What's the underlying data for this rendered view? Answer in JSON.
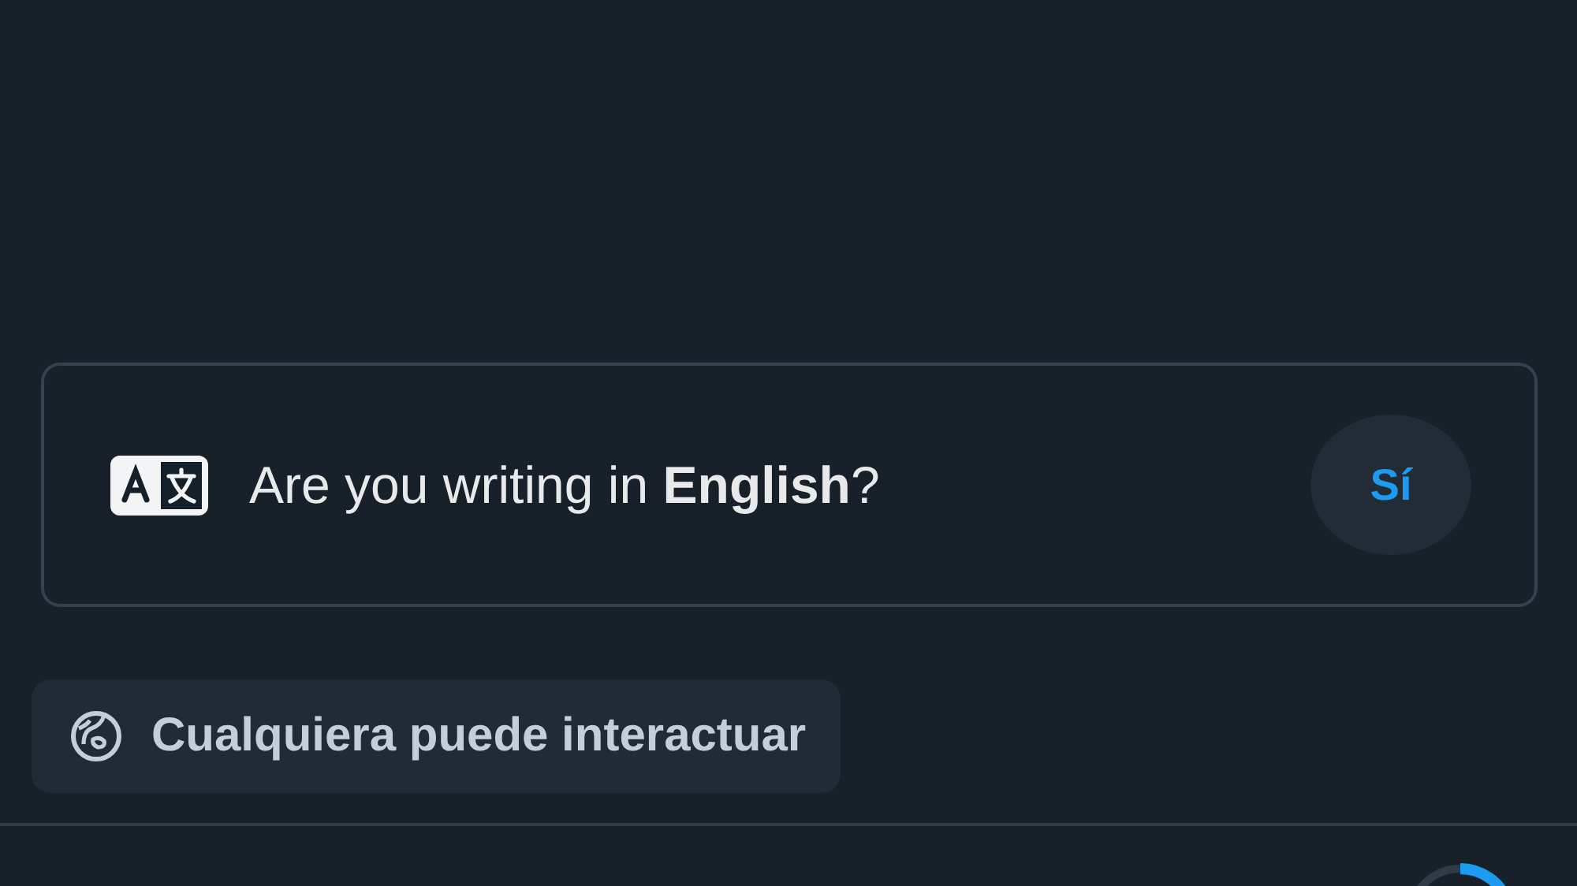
{
  "language_prompt": {
    "question": "Are you writing in **English**?",
    "button": "Sí"
  },
  "reply_setting": {
    "label": "Cualquiera puede interactuar"
  }
}
